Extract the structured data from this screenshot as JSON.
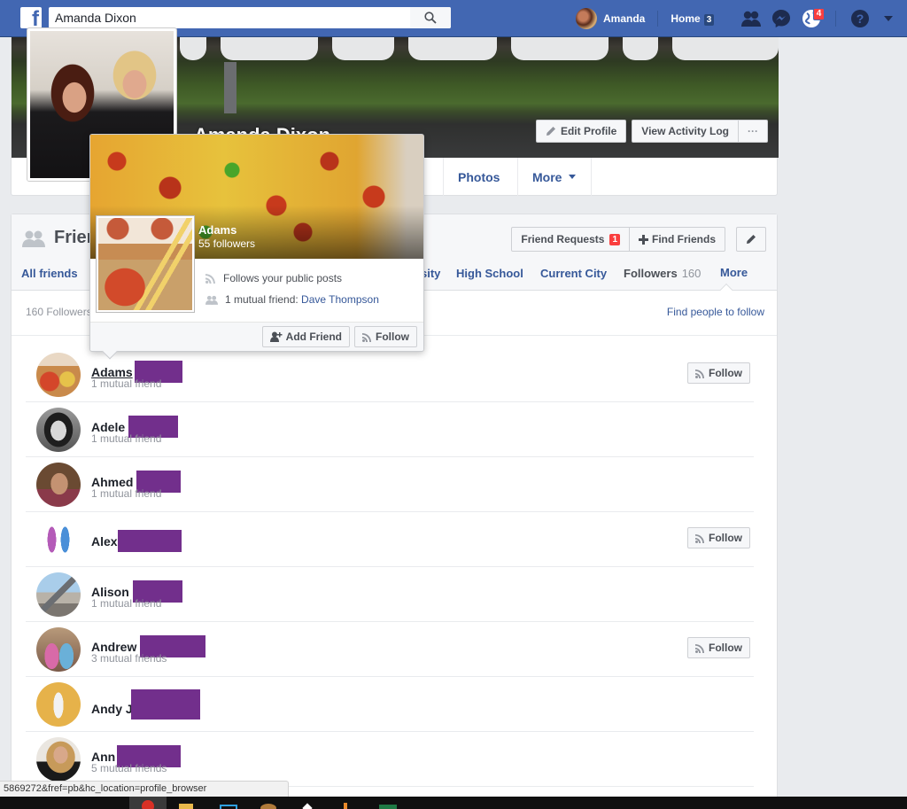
{
  "topbar": {
    "search_value": "Amanda Dixon",
    "search_icon": "search-icon",
    "user_name": "Amanda",
    "home_label": "Home",
    "home_count": "3",
    "notifications_count": "4",
    "icons": [
      "friend-requests-icon",
      "messenger-icon",
      "notifications-globe-icon",
      "help-icon",
      "account-menu-caret-icon"
    ]
  },
  "profile": {
    "name": "Amanda Dixon",
    "edit_profile": "Edit Profile",
    "view_activity_log": "View Activity Log",
    "more_dots": "···",
    "tabs": [
      {
        "label": "Photos"
      },
      {
        "label": "More"
      }
    ]
  },
  "friends_section": {
    "title": "Friends",
    "friend_requests_label": "Friend Requests",
    "friend_requests_count": "1",
    "find_friends_label": "Find Friends",
    "tabs": [
      {
        "label": "All friends"
      },
      {
        "label": "sity"
      },
      {
        "label": "High School"
      },
      {
        "label": "Current City"
      },
      {
        "label": "Followers",
        "count": "160",
        "active": true
      },
      {
        "label": "More"
      }
    ],
    "followers_count_label": "160 Followers",
    "find_people_link": "Find people to follow"
  },
  "followers": [
    {
      "name": "Adams",
      "mutual": "1 mutual friend",
      "follow": "Follow",
      "show_follow": true,
      "hovered": true
    },
    {
      "name": "Adele",
      "mutual": "1 mutual friend",
      "show_follow": false
    },
    {
      "name": "Ahmed",
      "mutual": "1 mutual friend",
      "show_follow": false
    },
    {
      "name": "Alex",
      "mutual": "",
      "follow": "Follow",
      "show_follow": true
    },
    {
      "name": "Alison",
      "mutual": "1 mutual friend",
      "show_follow": false
    },
    {
      "name": "Andrew",
      "mutual": "3 mutual friends",
      "follow": "Follow",
      "show_follow": true
    },
    {
      "name": "Andy J",
      "mutual": "",
      "show_follow": false
    },
    {
      "name": "Ann",
      "mutual": "5 mutual friends",
      "show_follow": false
    }
  ],
  "hovercard": {
    "name": "Adams",
    "followers": "55 followers",
    "follows_text": "Follows your public posts",
    "mutual_prefix": "1 mutual friend: ",
    "mutual_name": "Dave Thompson",
    "add_friend": "Add Friend",
    "follow": "Follow"
  },
  "status_bar": {
    "url": "5869272&fref=pb&hc_location=profile_browser"
  },
  "colors": {
    "brand_blue": "#4267b2",
    "link_blue": "#365899",
    "badge_red": "#fa3e3e",
    "redaction_purple": "#722f8c"
  }
}
